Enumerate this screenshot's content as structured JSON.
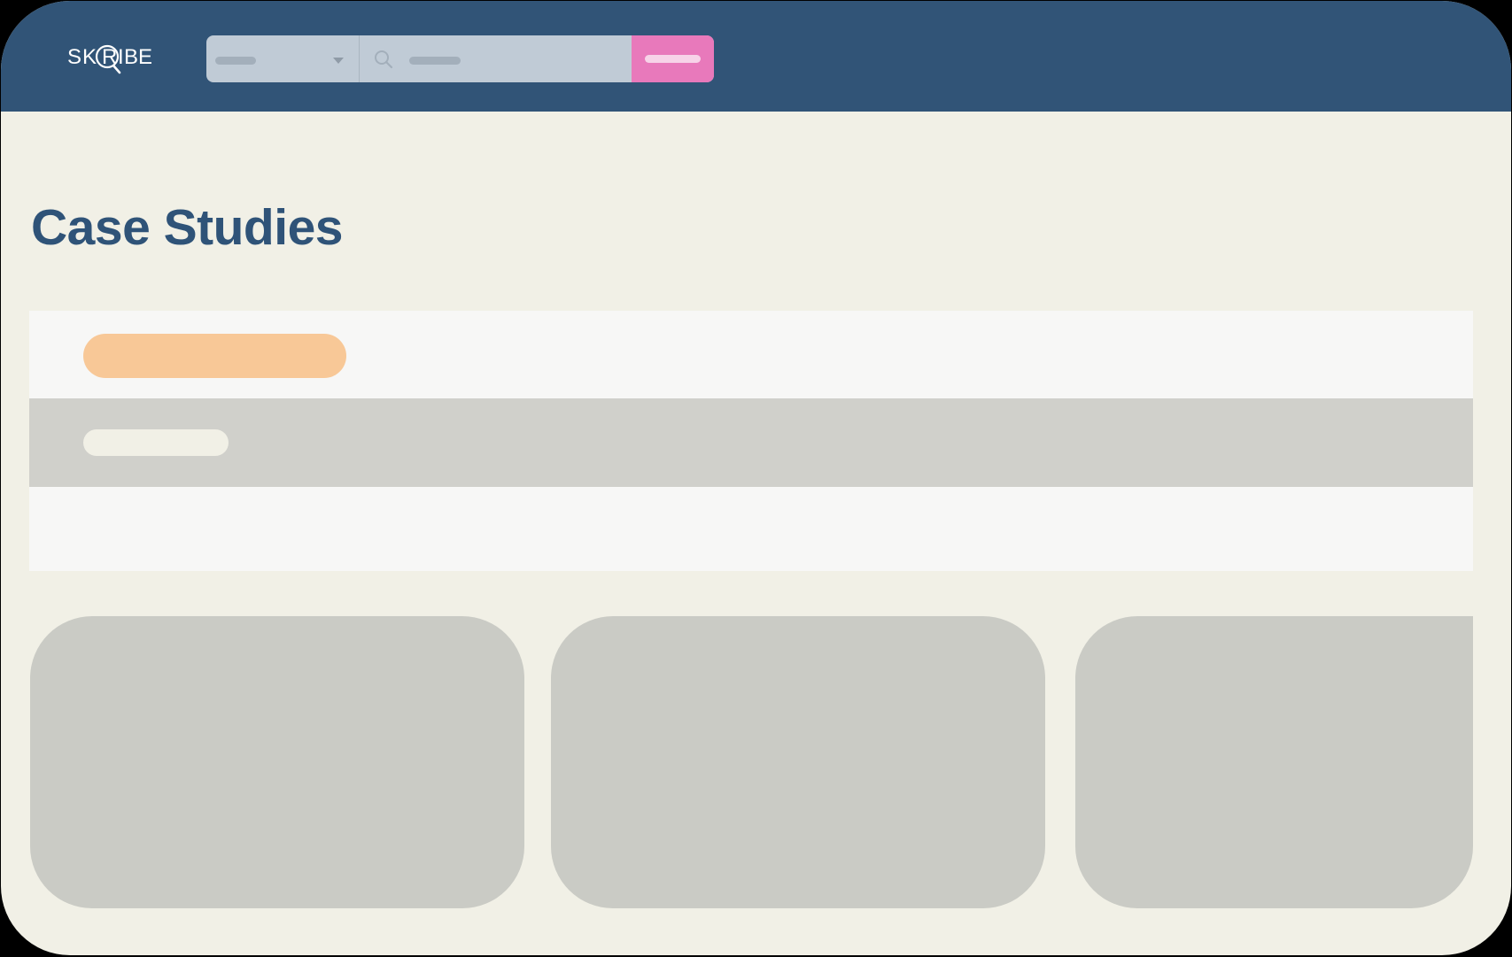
{
  "brand": {
    "logo_text": "SKRIBE",
    "header_color": "#315477",
    "accent_color": "#e879bb",
    "background_color": "#f1f0e6"
  },
  "search": {
    "category_select": {
      "icon": "chevron-down-icon"
    },
    "input": {
      "icon": "search-icon"
    }
  },
  "page": {
    "title": "Case Studies"
  },
  "filters": {
    "rows": [
      {
        "pill_color": "#f8c897"
      },
      {
        "pill_color": "#f1f0e6"
      },
      {}
    ]
  },
  "cards": [
    {
      "color": "#cacbc5"
    },
    {
      "color": "#cacbc5"
    },
    {
      "color": "#cacbc5"
    }
  ]
}
